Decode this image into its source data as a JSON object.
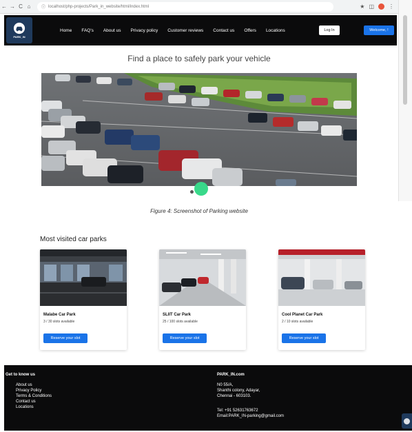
{
  "browser": {
    "url": "localhost/php-projects/Park_in_website/html/index.html",
    "nav_back": "←",
    "nav_forward": "→",
    "nav_reload": "C",
    "lock_glyph": "ⓘ"
  },
  "header": {
    "logo_text": "PARK_IN",
    "menu": [
      "Home",
      "FAQ's",
      "About us",
      "Privacy policy",
      "Customer reviews",
      "Contact us",
      "Offers",
      "Locations"
    ],
    "login_label": "Log In",
    "welcome_label": "Welcome, !"
  },
  "hero": {
    "title": "Find a place to safely park your vehicle",
    "dot_color": "#39d98a"
  },
  "caption": "Figure 4: Screenshot of Parking website",
  "section_title": "Most visited car parks",
  "cards": [
    {
      "name": "Malabe Car Park",
      "slots": "3 / 30 slots available",
      "button": "Reserve your slot"
    },
    {
      "name": "SLIIT Car Park",
      "slots": "25 / 100 slots available",
      "button": "Reserve your slot"
    },
    {
      "name": "Cool Planet Car Park",
      "slots": "2 / 10 slots available",
      "button": "Reserve your slot"
    }
  ],
  "footer": {
    "left_heading": "Get to know us",
    "links": [
      "About us",
      "Privacy Policy",
      "Terms & Conditions",
      "Contact us",
      "Locations"
    ],
    "right_heading": "PARK_IN.com",
    "address": [
      "N0 55/A,",
      "Shanthi colony, Adayar,",
      "Chennai - 603103."
    ],
    "tel": "Tel: +91 52631763672",
    "email": "Email:PARK_IN-parking@gmail.com"
  },
  "colors": {
    "header_bg": "#0b0b0c",
    "accent_blue": "#1a73e8",
    "logo_bg": "#1f3a5c"
  }
}
